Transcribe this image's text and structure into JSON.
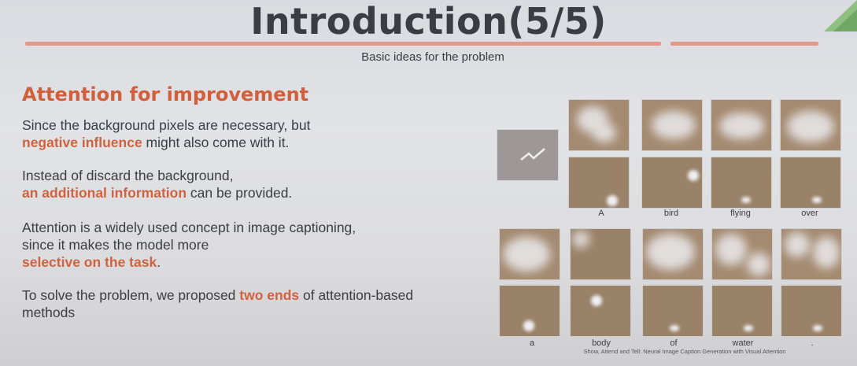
{
  "slide": {
    "title": "Introduction(5/5)",
    "subtitle": "Basic ideas for the problem",
    "heading": "Attention for improvement",
    "paragraphs": [
      {
        "pre": "Since the background pixels are necessary, but",
        "hl": "negative influence",
        "post": " might also come with it."
      },
      {
        "pre": "Instead of discard the background,",
        "hl": "an additional information",
        "post": " can be provided."
      },
      {
        "pre": "Attention is a widely used concept in image captioning, since it makes the model more",
        "hl": "selective on the task",
        "post": "."
      },
      {
        "pre": "To solve the problem, we proposed ",
        "hl": "two ends",
        "post": " of attention-based methods"
      }
    ]
  },
  "figure": {
    "row1_words": [
      "A",
      "bird",
      "flying",
      "over"
    ],
    "row2_words": [
      "a",
      "body",
      "of",
      "water",
      "."
    ],
    "footnote": "Show, Attend and Tell: Neural Image Caption Generation with Visual Attention"
  }
}
